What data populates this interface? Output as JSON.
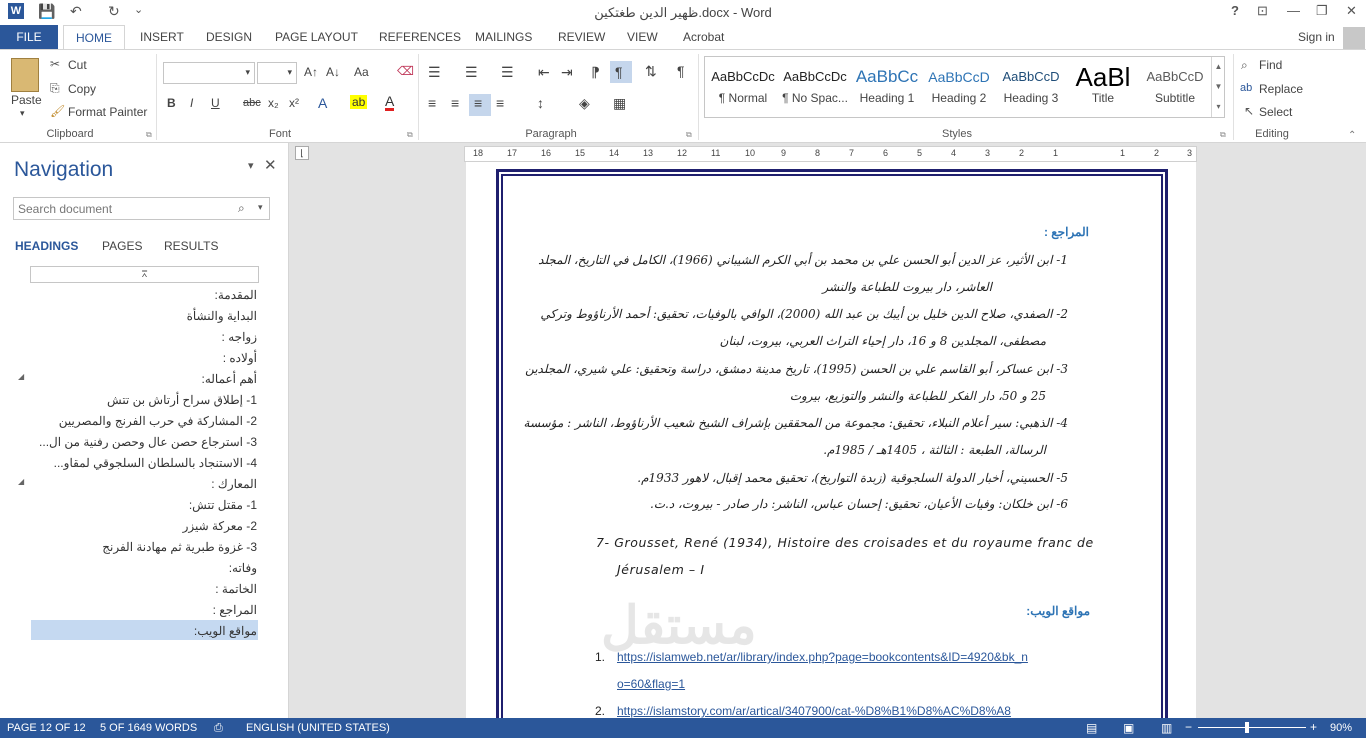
{
  "window": {
    "title": "ظهير الدين طغتكين.docx - Word",
    "help": "?",
    "minimize": "—",
    "restore": "❐",
    "close": "✕"
  },
  "quick_access": {
    "save": "💾",
    "undo": "↶",
    "redo": "↻",
    "more": "⌄"
  },
  "tabs": {
    "file": "FILE",
    "home": "HOME",
    "insert": "INSERT",
    "design": "DESIGN",
    "page_layout": "PAGE LAYOUT",
    "references": "REFERENCES",
    "mailings": "MAILINGS",
    "review": "REVIEW",
    "view": "VIEW",
    "acrobat": "Acrobat",
    "sign_in": "Sign in"
  },
  "clipboard": {
    "paste": "Paste",
    "cut": "Cut",
    "copy": "Copy",
    "format_painter": "Format Painter",
    "label": "Clipboard"
  },
  "font": {
    "label": "Font",
    "bold": "B",
    "italic": "I",
    "underline": "U",
    "strike": "abc",
    "sub": "x₂",
    "sup": "x²",
    "grow": "A↑",
    "shrink": "A↓",
    "case": "Aa",
    "font_color": "A",
    "highlight": "ab"
  },
  "paragraph": {
    "label": "Paragraph",
    "pilcrow": "¶"
  },
  "styles": {
    "label": "Styles",
    "items": [
      {
        "preview": "AaBbCcDc",
        "name": "¶ Normal"
      },
      {
        "preview": "AaBbCcDc",
        "name": "¶ No Spac..."
      },
      {
        "preview": "AaBbCc",
        "name": "Heading 1"
      },
      {
        "preview": "AaBbCcD",
        "name": "Heading 2"
      },
      {
        "preview": "AaBbCcD",
        "name": "Heading 3"
      },
      {
        "preview": "AaBl",
        "name": "Title"
      },
      {
        "preview": "AaBbCcD",
        "name": "Subtitle"
      }
    ]
  },
  "editing": {
    "label": "Editing",
    "find": "Find",
    "replace": "Replace",
    "select": "Select"
  },
  "navigation": {
    "title": "Navigation",
    "search_placeholder": "Search document",
    "tabs": {
      "headings": "HEADINGS",
      "pages": "PAGES",
      "results": "RESULTS"
    },
    "headings": [
      "المقدمة:",
      "البداية والنشأة",
      "زواجه :",
      "أولاده :",
      "أهم أعماله:",
      "1- إطلاق سراح أرتاش بن تتش",
      "2- المشاركة في حرب الفرنج والمصريين",
      "3- استرجاع حصن عال وحصن رفنية من ال...",
      "4- الاستنجاد بالسلطان السلجوقي لمقاو...",
      "المعارك :",
      "1- مقتل تتش:",
      "2- معركة شيزر",
      "3- غزوة طبرية ثم مهادنة الفرنج",
      "وفاته:",
      "الخاتمة :",
      "المراجع :",
      "مواقع الويب:"
    ]
  },
  "ruler": {
    "ticks": [
      "18",
      "17",
      "16",
      "15",
      "14",
      "13",
      "12",
      "11",
      "10",
      "9",
      "8",
      "7",
      "6",
      "5",
      "4",
      "3",
      "2",
      "1",
      "1",
      "2",
      "3"
    ]
  },
  "document": {
    "refs_heading": "المراجع :",
    "refs": [
      "1- ابن الأثير، عز الدين أبو الحسن علي بن محمد بن أبي الكرم الشيباني (1966)، الكامل في التاريخ، المجلد",
      "العاشر، دار بيروت للطباعة والنشر",
      "2- الصفدي، صلاح الدين خليل بن أيبك بن عبد الله (2000)، الوافي بالوفيات، تحقيق: أحمد الأرناؤوط وتركي",
      "مصطفى، المجلدين 8 و 16، دار إحياء التراث العربي، بيروت، لبنان",
      "3- ابن عساكر، أبو القاسم علي بن الحسن (1995)، تاريخ مدينة دمشق، دراسة وتحقيق: علي شيري، المجلدين",
      "25 و 50، دار الفكر للطباعة والنشر والتوزيع، بيروت",
      "4- الذهبي: سير أعلام النبلاء، تحقيق: مجموعة من المحققين بإشراف الشيخ شعيب الأرناؤوط، الناشر : مؤسسة",
      "الرسالة، الطبعة : الثالثة ، 1405هـ / 1985م.",
      "5- الحسيني، أخبار الدولة السلجوقية (زبدة التواريخ)، تحقيق محمد إقبال، لاهور 1933م.",
      "6- ابن خلكان: وفيات الأعيان، تحقيق: إحسان عباس، الناشر: دار صادر - بيروت، د.ت."
    ],
    "ref7_line1": "7- Grousset, René (1934), Histoire des croisades et du royaume franc de",
    "ref7_line2": "Jérusalem – I",
    "web_heading": "مواقع الويب:",
    "web_num1": "1.",
    "web_link1a": "https://islamweb.net/ar/library/index.php?page=bookcontents&ID=4920&bk_n",
    "web_link1b": "o=60&flag=1",
    "web_num2": "2.",
    "web_link2": "https://islamstory.com/ar/artical/3407900/cat-%D8%B1%D8%AC%D8%A8",
    "watermark": "مستقل"
  },
  "status": {
    "page": "PAGE 12 OF 12",
    "words": "5 OF 1649 WORDS",
    "language": "ENGLISH (UNITED STATES)",
    "zoom": "90%"
  },
  "colors": {
    "accent": "#2b579a",
    "frame": "#1f1f6e",
    "heading_blue": "#2e74b5"
  }
}
